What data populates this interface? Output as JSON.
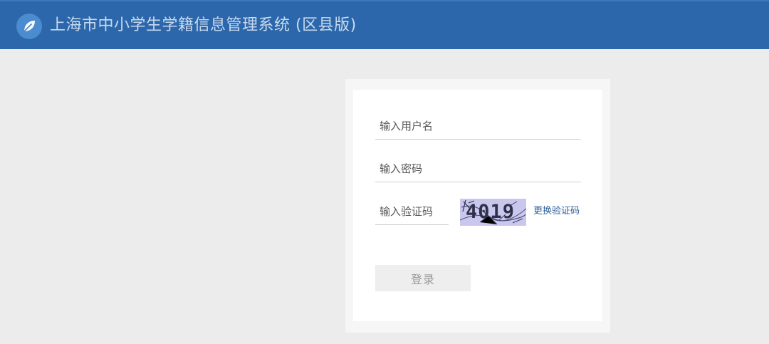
{
  "header": {
    "title": "上海市中小学生学籍信息管理系统 (区县版)",
    "logo_icon": "leaf-icon"
  },
  "login": {
    "username_placeholder": "输入用户名",
    "username_value": "",
    "password_placeholder": "输入密码",
    "password_value": "",
    "captcha_placeholder": "输入验证码",
    "captcha_value": "",
    "captcha_code": "4019",
    "change_captcha_label": "更换验证码",
    "submit_label": "登录"
  },
  "colors": {
    "header_bg": "#2b67aa",
    "page_bg": "#ececec",
    "link": "#2f5f98",
    "captcha_bg": "#c9c7ee"
  }
}
